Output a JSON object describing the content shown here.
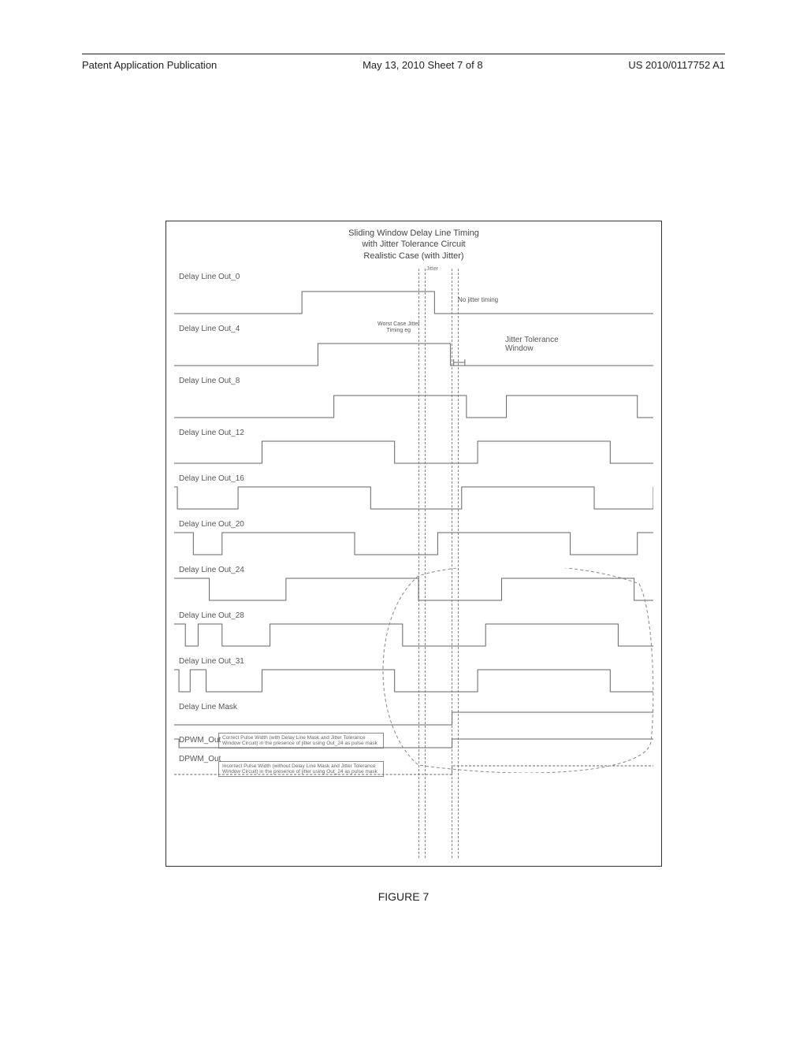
{
  "header": {
    "left": "Patent Application Publication",
    "center": "May 13, 2010   Sheet 7 of 8",
    "right": "US 2010/0117752 A1"
  },
  "figure": {
    "title_line1": "Sliding Window Delay Line Timing",
    "title_line2": "with Jitter Tolerance Circuit",
    "title_line3": "Realistic Case (with Jitter)",
    "rows": {
      "r0": "Delay Line Out_0",
      "r4": "Delay Line Out_4",
      "r8": "Delay Line Out_8",
      "r12": "Delay Line Out_12",
      "r16": "Delay Line Out_16",
      "r20": "Delay Line Out_20",
      "r24": "Delay Line Out_24",
      "r28": "Delay Line Out_28",
      "r31": "Delay Line Out_31",
      "mask": "Delay Line Mask",
      "dpwm1": "DPWM_Out",
      "dpwm2": "DPWM_Out"
    },
    "annotations": {
      "jitter_small": "Jitter",
      "no_jitter": "No jitter timing",
      "worst_case": "Worst Case Jitter",
      "timing_eg": "Timing eg",
      "tol_window": "Jitter Tolerance",
      "tol_window2": "Window"
    },
    "notes": {
      "n1": "Correct Pulse Width (with Delay Line Mask and Jitter Tolerance Window Circuit) in the presence of jitter using Out_24 as pulse mask",
      "n2": "Incorrect Pulse Width (without Delay Line Mask and Jitter Tolerance Window Circuit) in the presence of jitter using Out_24 as pulse mask"
    }
  },
  "caption": "FIGURE 7"
}
